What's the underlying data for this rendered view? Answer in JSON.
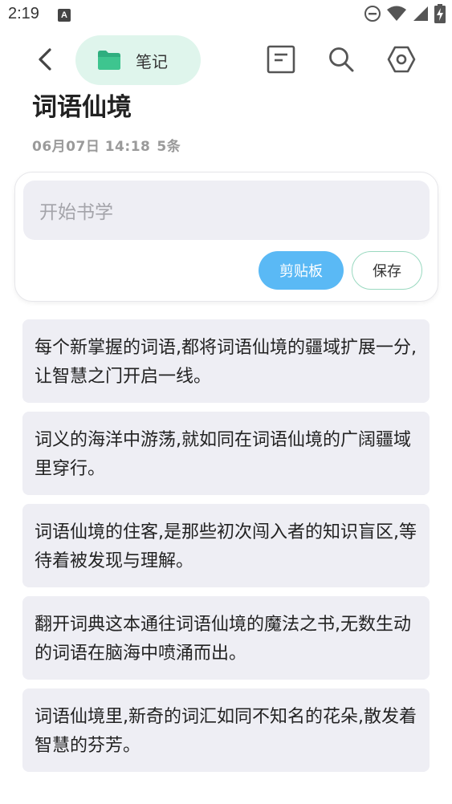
{
  "status_bar": {
    "time": "2:19",
    "notification_icon_letter": "A",
    "icons": [
      "do-not-disturb-icon",
      "wifi-icon",
      "cellular-signal-icon",
      "battery-charging-icon"
    ]
  },
  "toolbar": {
    "back_icon": "chevron-left-icon",
    "notebook_label": "笔记",
    "notebook_icon": "folder-icon",
    "actions": [
      "note-outline-icon",
      "search-icon",
      "settings-hexagon-icon"
    ]
  },
  "page": {
    "title": "词语仙境",
    "date": "06月07日 14:18",
    "count": "5条"
  },
  "composer": {
    "placeholder": "开始书学",
    "paste_label": "剪贴板",
    "save_label": "保存"
  },
  "notes": [
    "每个新掌握的词语,都将词语仙境的疆域扩展一分,让智慧之门开启一线。",
    "词义的海洋中游荡,就如同在词语仙境的广阔疆域里穿行。",
    "词语仙境的住客,是那些初次闯入者的知识盲区,等待着被发现与理解。",
    "翻开词典这本通往词语仙境的魔法之书,无数生动的词语在脑海中喷涌而出。",
    "词语仙境里,新奇的词汇如同不知名的花朵,散发着智慧的芬芳。"
  ],
  "colors": {
    "chip_bg": "#dff5ec",
    "folder": "#2fae7f",
    "paste_button": "#5ab9f5",
    "save_border": "#9ad9c0",
    "card_bg": "#eeeef4",
    "meta_text": "#9a9a9a"
  }
}
